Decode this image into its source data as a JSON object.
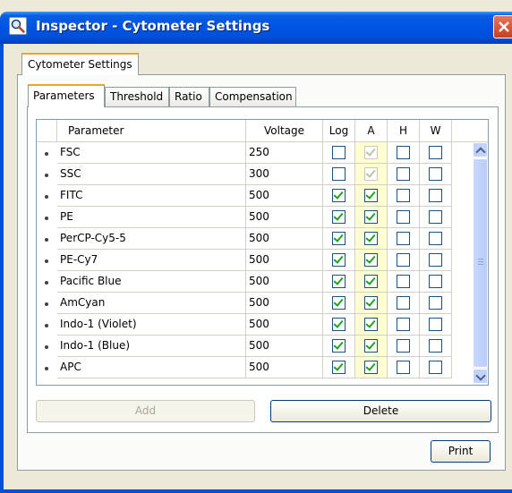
{
  "window": {
    "title": "Inspector - Cytometer Settings"
  },
  "outer_tab": {
    "label": "Cytometer Settings"
  },
  "tabs": [
    {
      "label": "Parameters",
      "active": true
    },
    {
      "label": "Threshold",
      "active": false
    },
    {
      "label": "Ratio",
      "active": false
    },
    {
      "label": "Compensation",
      "active": false
    }
  ],
  "grid": {
    "columns": [
      "Parameter",
      "Voltage",
      "Log",
      "A",
      "H",
      "W"
    ],
    "rows": [
      {
        "parameter": "FSC",
        "voltage": "250",
        "log": false,
        "a": true,
        "a_disabled": true,
        "h": false,
        "w": false
      },
      {
        "parameter": "SSC",
        "voltage": "300",
        "log": false,
        "a": true,
        "a_disabled": true,
        "h": false,
        "w": false
      },
      {
        "parameter": "FITC",
        "voltage": "500",
        "log": true,
        "a": true,
        "a_disabled": false,
        "h": false,
        "w": false
      },
      {
        "parameter": "PE",
        "voltage": "500",
        "log": true,
        "a": true,
        "a_disabled": false,
        "h": false,
        "w": false
      },
      {
        "parameter": "PerCP-Cy5-5",
        "voltage": "500",
        "log": true,
        "a": true,
        "a_disabled": false,
        "h": false,
        "w": false
      },
      {
        "parameter": "PE-Cy7",
        "voltage": "500",
        "log": true,
        "a": true,
        "a_disabled": false,
        "h": false,
        "w": false
      },
      {
        "parameter": "Pacific Blue",
        "voltage": "500",
        "log": true,
        "a": true,
        "a_disabled": false,
        "h": false,
        "w": false
      },
      {
        "parameter": "AmCyan",
        "voltage": "500",
        "log": true,
        "a": true,
        "a_disabled": false,
        "h": false,
        "w": false
      },
      {
        "parameter": "Indo-1 (Violet)",
        "voltage": "500",
        "log": true,
        "a": true,
        "a_disabled": false,
        "h": false,
        "w": false
      },
      {
        "parameter": "Indo-1 (Blue)",
        "voltage": "500",
        "log": true,
        "a": true,
        "a_disabled": false,
        "h": false,
        "w": false
      },
      {
        "parameter": "APC",
        "voltage": "500",
        "log": true,
        "a": true,
        "a_disabled": false,
        "h": false,
        "w": false
      }
    ]
  },
  "buttons": {
    "add": "Add",
    "delete": "Delete",
    "print": "Print"
  },
  "colors": {
    "titlebar": "#0054e3",
    "tab_highlight": "#f0a430",
    "area_column": "#fffed0",
    "check": "#21a121"
  }
}
